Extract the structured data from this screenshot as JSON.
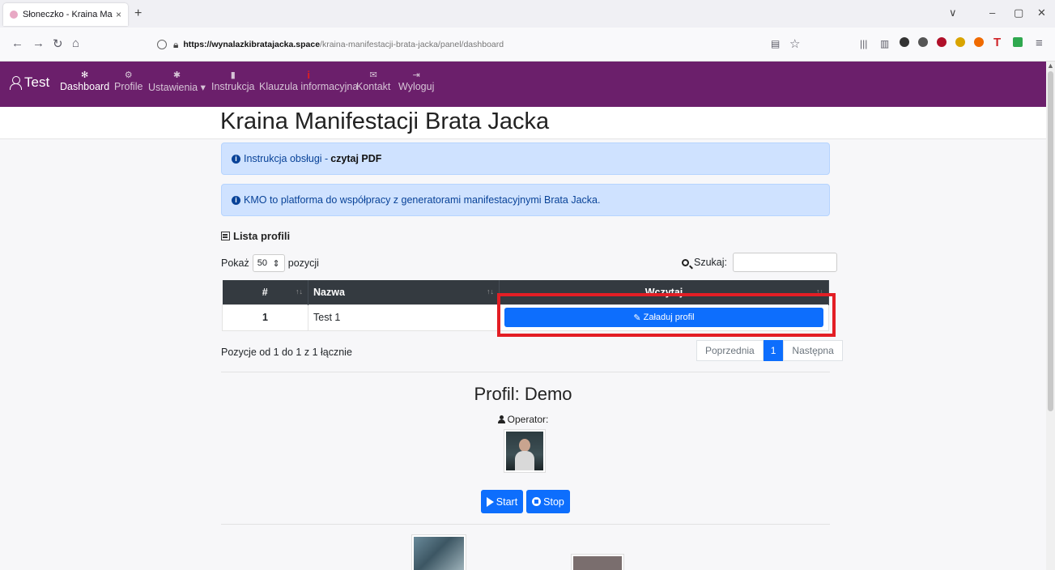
{
  "browser": {
    "tab_title": "Słoneczko - Kraina Manifestacji",
    "tab_close": "×",
    "new_tab": "+",
    "url_host": "https://wynalazkibratajacka.space",
    "url_path": "/kraina-manifestacji-brata-jacka/panel/dashboard",
    "icons": [
      "back-icon",
      "forward-icon",
      "reload-icon",
      "home-icon",
      "shield-icon",
      "lock-icon",
      "reader-icon",
      "bookmark-star-icon",
      "library-icon",
      "sidebar-icon",
      "extension-icons",
      "menu-icon"
    ]
  },
  "navbar": {
    "brand": "Test",
    "items": [
      {
        "label": "Dashboard",
        "icon": "✻"
      },
      {
        "label": "Profile",
        "icon": "⚙"
      },
      {
        "label": "Ustawienia ▾",
        "icon": "✱"
      },
      {
        "label": "Instrukcja",
        "icon": "▮"
      },
      {
        "label": "Klauzula informacyjna",
        "icon": "i"
      },
      {
        "label": "Kontakt",
        "icon": "✉"
      },
      {
        "label": "Wyloguj",
        "icon": "⇥"
      }
    ],
    "bg_color": "#6b1f6b"
  },
  "page": {
    "title": "Kraina Manifestacji Brata Jacka",
    "alert1_text": "Instrukcja obsługi - ",
    "alert1_link": "czytaj PDF",
    "alert2_text": "KMO to platforma do współpracy z generatorami manifestacyjnymi Brata Jacka."
  },
  "profiles": {
    "section_title": "Lista profili",
    "show_label": "Pokaż",
    "show_value": "50",
    "show_suffix": "pozycji",
    "search_label": "Szukaj:",
    "columns": [
      "#",
      "Nazwa",
      "Wczytaj"
    ],
    "rows": [
      {
        "num": "1",
        "name": "Test 1",
        "action": "Załaduj profil"
      }
    ],
    "info": "Pozycje od 1 do 1 z 1 łącznie",
    "pager": {
      "prev": "Poprzednia",
      "current": "1",
      "next": "Następna"
    }
  },
  "profile": {
    "title": "Profil: Demo",
    "operator_label": "Operator:",
    "start_label": "Start",
    "stop_label": "Stop"
  },
  "colors": {
    "primary": "#0d6efd",
    "highlight": "#e31e25",
    "alert_bg": "#cfe2ff"
  }
}
